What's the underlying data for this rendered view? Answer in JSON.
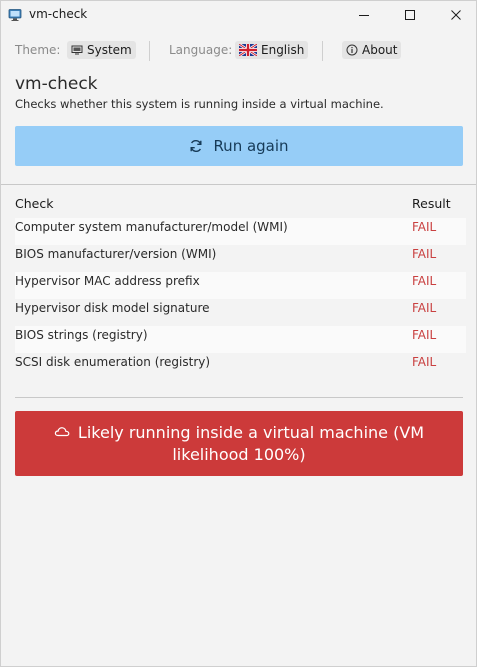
{
  "window": {
    "title": "vm-check"
  },
  "toolbar": {
    "theme_label": "Theme:",
    "theme_value": "System",
    "language_label": "Language:",
    "language_value": "English",
    "about_label": "About"
  },
  "header": {
    "title": "vm-check",
    "description": "Checks whether this system is running inside a virtual machine."
  },
  "run_button": {
    "label": "Run again",
    "color": "#96cdf7"
  },
  "table": {
    "columns": [
      "Check",
      "Result"
    ],
    "rows": [
      {
        "check": "Computer system manufacturer/model (WMI)",
        "result": "FAIL"
      },
      {
        "check": "BIOS manufacturer/version (WMI)",
        "result": "FAIL"
      },
      {
        "check": "Hypervisor MAC address prefix",
        "result": "FAIL"
      },
      {
        "check": "Hypervisor disk model signature",
        "result": "FAIL"
      },
      {
        "check": "BIOS strings (registry)",
        "result": "FAIL"
      },
      {
        "check": "SCSI disk enumeration (registry)",
        "result": "FAIL"
      }
    ],
    "fail_color": "#c94040"
  },
  "verdict": {
    "text": "Likely running inside a virtual machine (VM likelihood 100%)",
    "icon": "cloud-icon",
    "color": "#cc3a3a"
  }
}
